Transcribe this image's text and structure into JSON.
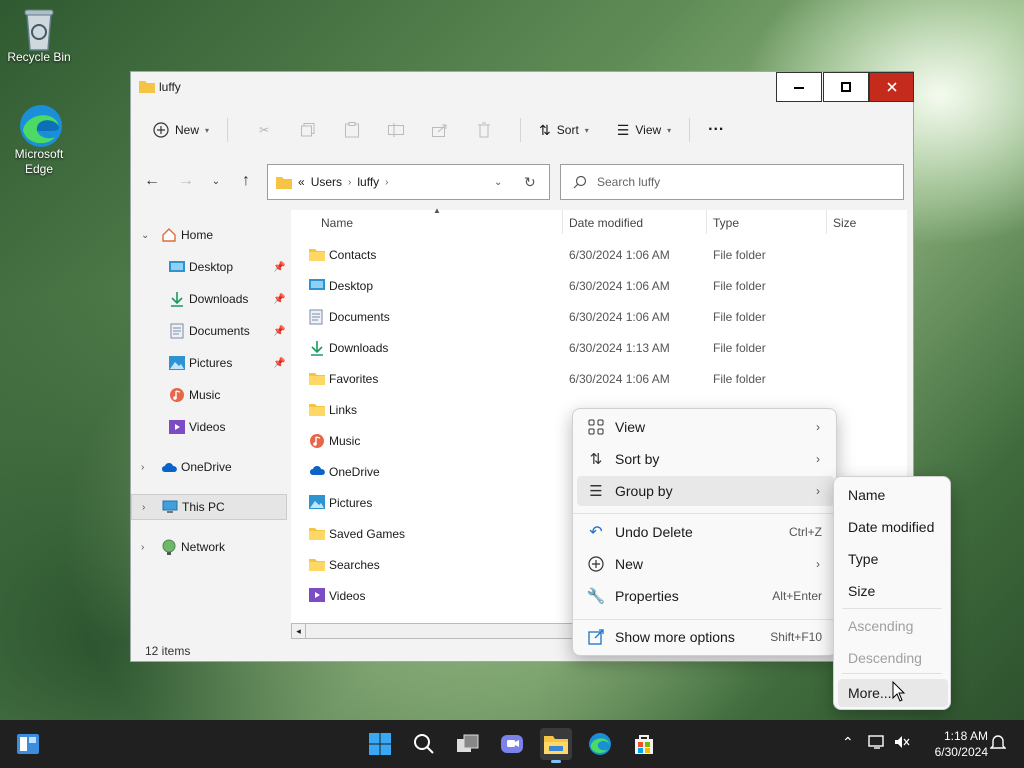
{
  "desktop": {
    "icons": [
      {
        "label": "Recycle Bin"
      },
      {
        "label": "Microsoft Edge"
      }
    ]
  },
  "window": {
    "title": "luffy",
    "toolbar": {
      "new_label": "New",
      "sort_label": "Sort",
      "view_label": "View",
      "more_label": "···"
    },
    "address": {
      "prefix": "«",
      "crumbs": [
        "Users",
        "luffy"
      ]
    },
    "search_placeholder": "Search luffy",
    "sidebar": [
      {
        "label": "Home",
        "icon": "home-icon"
      },
      {
        "label": "Desktop",
        "icon": "desktop-icon"
      },
      {
        "label": "Downloads",
        "icon": "download-icon"
      },
      {
        "label": "Documents",
        "icon": "document-icon"
      },
      {
        "label": "Pictures",
        "icon": "pictures-icon"
      },
      {
        "label": "Music",
        "icon": "music-icon"
      },
      {
        "label": "Videos",
        "icon": "video-icon"
      },
      {
        "label": "OneDrive",
        "icon": "cloud-icon"
      },
      {
        "label": "This PC",
        "icon": "pc-icon"
      },
      {
        "label": "Network",
        "icon": "network-icon"
      }
    ],
    "columns": {
      "name": "Name",
      "date": "Date modified",
      "type": "Type",
      "size": "Size"
    },
    "files": [
      {
        "name": "Contacts",
        "date": "6/30/2024 1:06 AM",
        "type": "File folder",
        "icon": "folder-icon"
      },
      {
        "name": "Desktop",
        "date": "6/30/2024 1:06 AM",
        "type": "File folder",
        "icon": "desktop-icon"
      },
      {
        "name": "Documents",
        "date": "6/30/2024 1:06 AM",
        "type": "File folder",
        "icon": "document-icon"
      },
      {
        "name": "Downloads",
        "date": "6/30/2024 1:13 AM",
        "type": "File folder",
        "icon": "download-icon"
      },
      {
        "name": "Favorites",
        "date": "6/30/2024 1:06 AM",
        "type": "File folder",
        "icon": "folder-icon"
      },
      {
        "name": "Links",
        "date": "",
        "type": "",
        "icon": "folder-icon"
      },
      {
        "name": "Music",
        "date": "",
        "type": "",
        "icon": "music-icon"
      },
      {
        "name": "OneDrive",
        "date": "",
        "type": "",
        "icon": "cloud-icon"
      },
      {
        "name": "Pictures",
        "date": "",
        "type": "",
        "icon": "pictures-icon"
      },
      {
        "name": "Saved Games",
        "date": "",
        "type": "",
        "icon": "folder-icon"
      },
      {
        "name": "Searches",
        "date": "",
        "type": "",
        "icon": "folder-icon"
      },
      {
        "name": "Videos",
        "date": "",
        "type": "",
        "icon": "video-icon"
      }
    ],
    "status": "12 items"
  },
  "context_menu": {
    "items": [
      {
        "label": "View",
        "shortcut": "",
        "submenu": true,
        "icon": "grid-icon"
      },
      {
        "label": "Sort by",
        "shortcut": "",
        "submenu": true,
        "icon": "sort-icon"
      },
      {
        "label": "Group by",
        "shortcut": "",
        "submenu": true,
        "icon": "list-icon"
      },
      {
        "label": "Undo Delete",
        "shortcut": "Ctrl+Z",
        "submenu": false,
        "icon": "undo-icon"
      },
      {
        "label": "New",
        "shortcut": "",
        "submenu": true,
        "icon": "plus-icon"
      },
      {
        "label": "Properties",
        "shortcut": "Alt+Enter",
        "submenu": false,
        "icon": "wrench-icon"
      },
      {
        "label": "Show more options",
        "shortcut": "Shift+F10",
        "submenu": false,
        "icon": "more-options-icon"
      }
    ],
    "arrow": "›"
  },
  "group_by_submenu": {
    "items": [
      {
        "label": "Name",
        "disabled": false
      },
      {
        "label": "Date modified",
        "disabled": false
      },
      {
        "label": "Type",
        "disabled": false
      },
      {
        "label": "Size",
        "disabled": false
      },
      {
        "label": "Ascending",
        "disabled": true
      },
      {
        "label": "Descending",
        "disabled": true
      },
      {
        "label": "More...",
        "disabled": false
      }
    ]
  },
  "taskbar": {
    "time": "1:18 AM",
    "date": "6/30/2024"
  },
  "colors": {
    "folder": "#f6c445",
    "accent": "#0067c0",
    "close": "#c42b1c"
  }
}
